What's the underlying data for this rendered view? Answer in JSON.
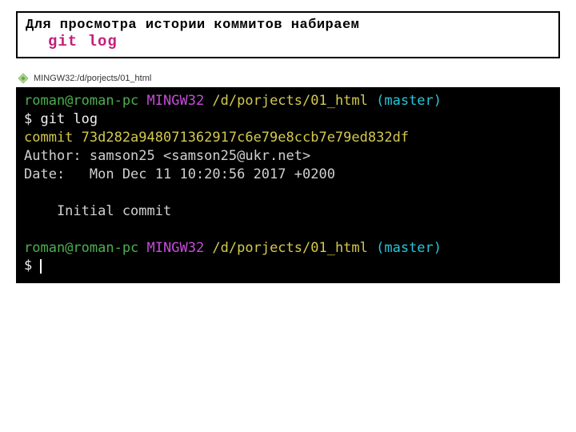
{
  "note": {
    "line1": "Для просмотра истории коммитов набираем",
    "line2": "git log"
  },
  "titlebar": {
    "text": "MINGW32:/d/porjects/01_html"
  },
  "term": {
    "p1_user": "roman@roman-pc",
    "p1_env": " MINGW32",
    "p1_path": " /d/porjects/01_html",
    "p1_branch": " (master)",
    "cmd_prefix": "$ ",
    "cmd": "git log",
    "commit_line": "commit 73d282a948071362917c6e79e8ccb7e79ed832df",
    "author_line": "Author: samson25 <samson25@ukr.net>",
    "date_line": "Date:   Mon Dec 11 10:20:56 2017 +0200",
    "msg_line": "    Initial commit",
    "p2_user": "roman@roman-pc",
    "p2_env": " MINGW32",
    "p2_path": " /d/porjects/01_html",
    "p2_branch": " (master)",
    "cmd2_prefix": "$ "
  }
}
